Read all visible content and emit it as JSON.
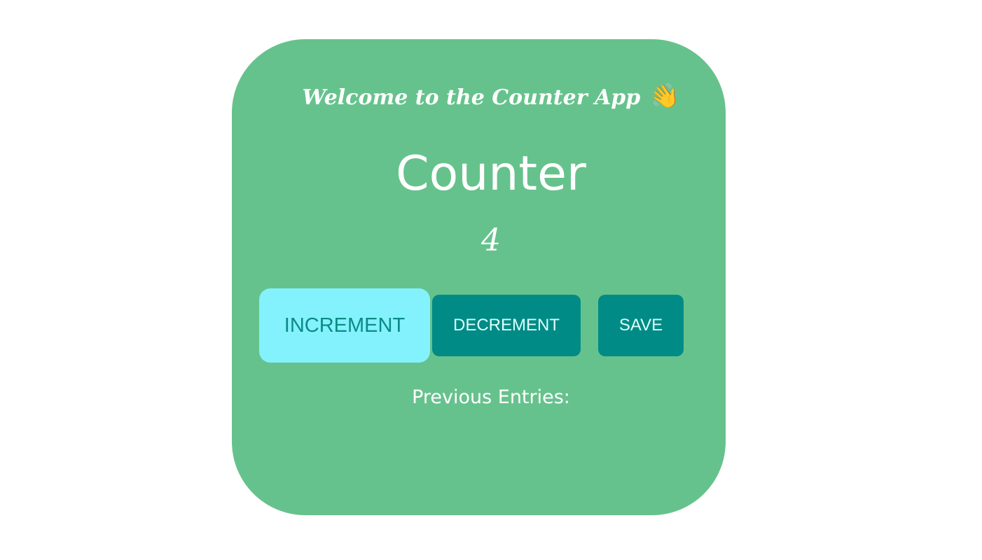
{
  "app": {
    "welcome_text": "Welcome to the Counter App",
    "wave_icon": "👋",
    "title": "Counter",
    "count": "4"
  },
  "buttons": {
    "increment_label": "INCREMENT",
    "decrement_label": "DECREMENT",
    "save_label": "SAVE"
  },
  "entries": {
    "heading": "Previous Entries:",
    "items": []
  },
  "colors": {
    "card_background": "#66c28c",
    "increment_background": "#84f2fd",
    "button_background": "#008b86",
    "text": "#ffffff"
  }
}
